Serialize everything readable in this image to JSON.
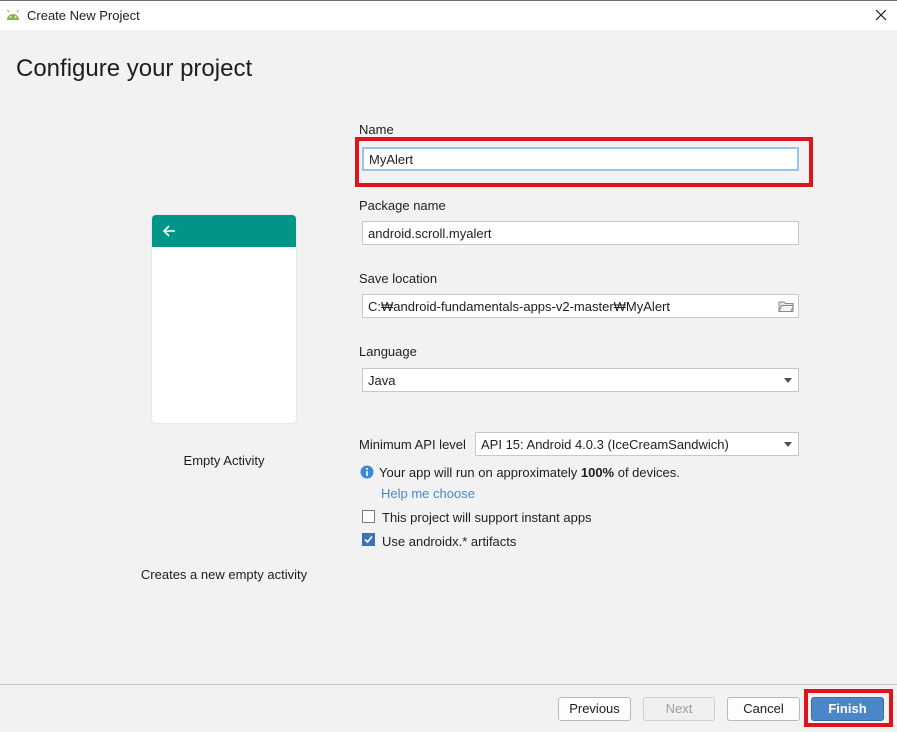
{
  "window": {
    "title": "Create New Project",
    "icon": "android-icon"
  },
  "page": {
    "title": "Configure your project"
  },
  "template": {
    "name": "Empty Activity",
    "description": "Creates a new empty activity"
  },
  "form": {
    "name": {
      "label": "Name",
      "value": "MyAlert"
    },
    "package": {
      "label": "Package name",
      "value": "android.scroll.myalert"
    },
    "save_location": {
      "label": "Save location",
      "value": "C:₩android-fundamentals-apps-v2-master₩MyAlert"
    },
    "language": {
      "label": "Language",
      "value": "Java"
    },
    "min_api": {
      "label": "Minimum API level",
      "value": "API 15: Android 4.0.3 (IceCreamSandwich)"
    },
    "info": {
      "prefix": "Your app will run on approximately ",
      "percent": "100%",
      "suffix": " of devices."
    },
    "help_link": "Help me choose",
    "instant_apps": {
      "label": "This project will support instant apps",
      "checked": false
    },
    "androidx": {
      "label": "Use androidx.* artifacts",
      "checked": true
    }
  },
  "buttons": {
    "previous": "Previous",
    "next": "Next",
    "cancel": "Cancel",
    "finish": "Finish"
  },
  "colors": {
    "accent": "#009587",
    "highlight": "#e0131b",
    "primary_button": "#4a86c8",
    "link": "#4a87d0"
  }
}
